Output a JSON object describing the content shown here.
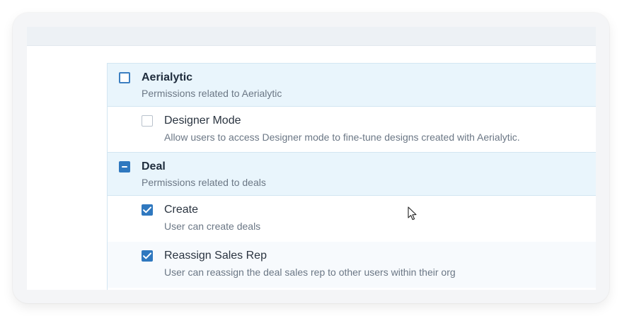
{
  "groups": [
    {
      "title": "Aerialytic",
      "subtitle": "Permissions related to Aerialytic",
      "state": "unchecked",
      "permissions": [
        {
          "name": "Designer Mode",
          "description": "Allow users to access Designer mode to fine-tune designs created with Aerialytic.",
          "checked": false
        }
      ]
    },
    {
      "title": "Deal",
      "subtitle": "Permissions related to deals",
      "state": "indeterminate",
      "permissions": [
        {
          "name": "Create",
          "description": "User can create deals",
          "checked": true
        },
        {
          "name": "Reassign Sales Rep",
          "description": "User can reassign the deal sales rep to other users within their org",
          "checked": true
        }
      ]
    }
  ],
  "colors": {
    "accent": "#2f78bf",
    "group_background": "#e9f5fc",
    "title_text": "#1f2d3d",
    "description_text": "#6b7785"
  },
  "icons": {
    "check": "check-icon",
    "indeterminate": "minus-icon",
    "cursor": "mouse-pointer-icon"
  }
}
